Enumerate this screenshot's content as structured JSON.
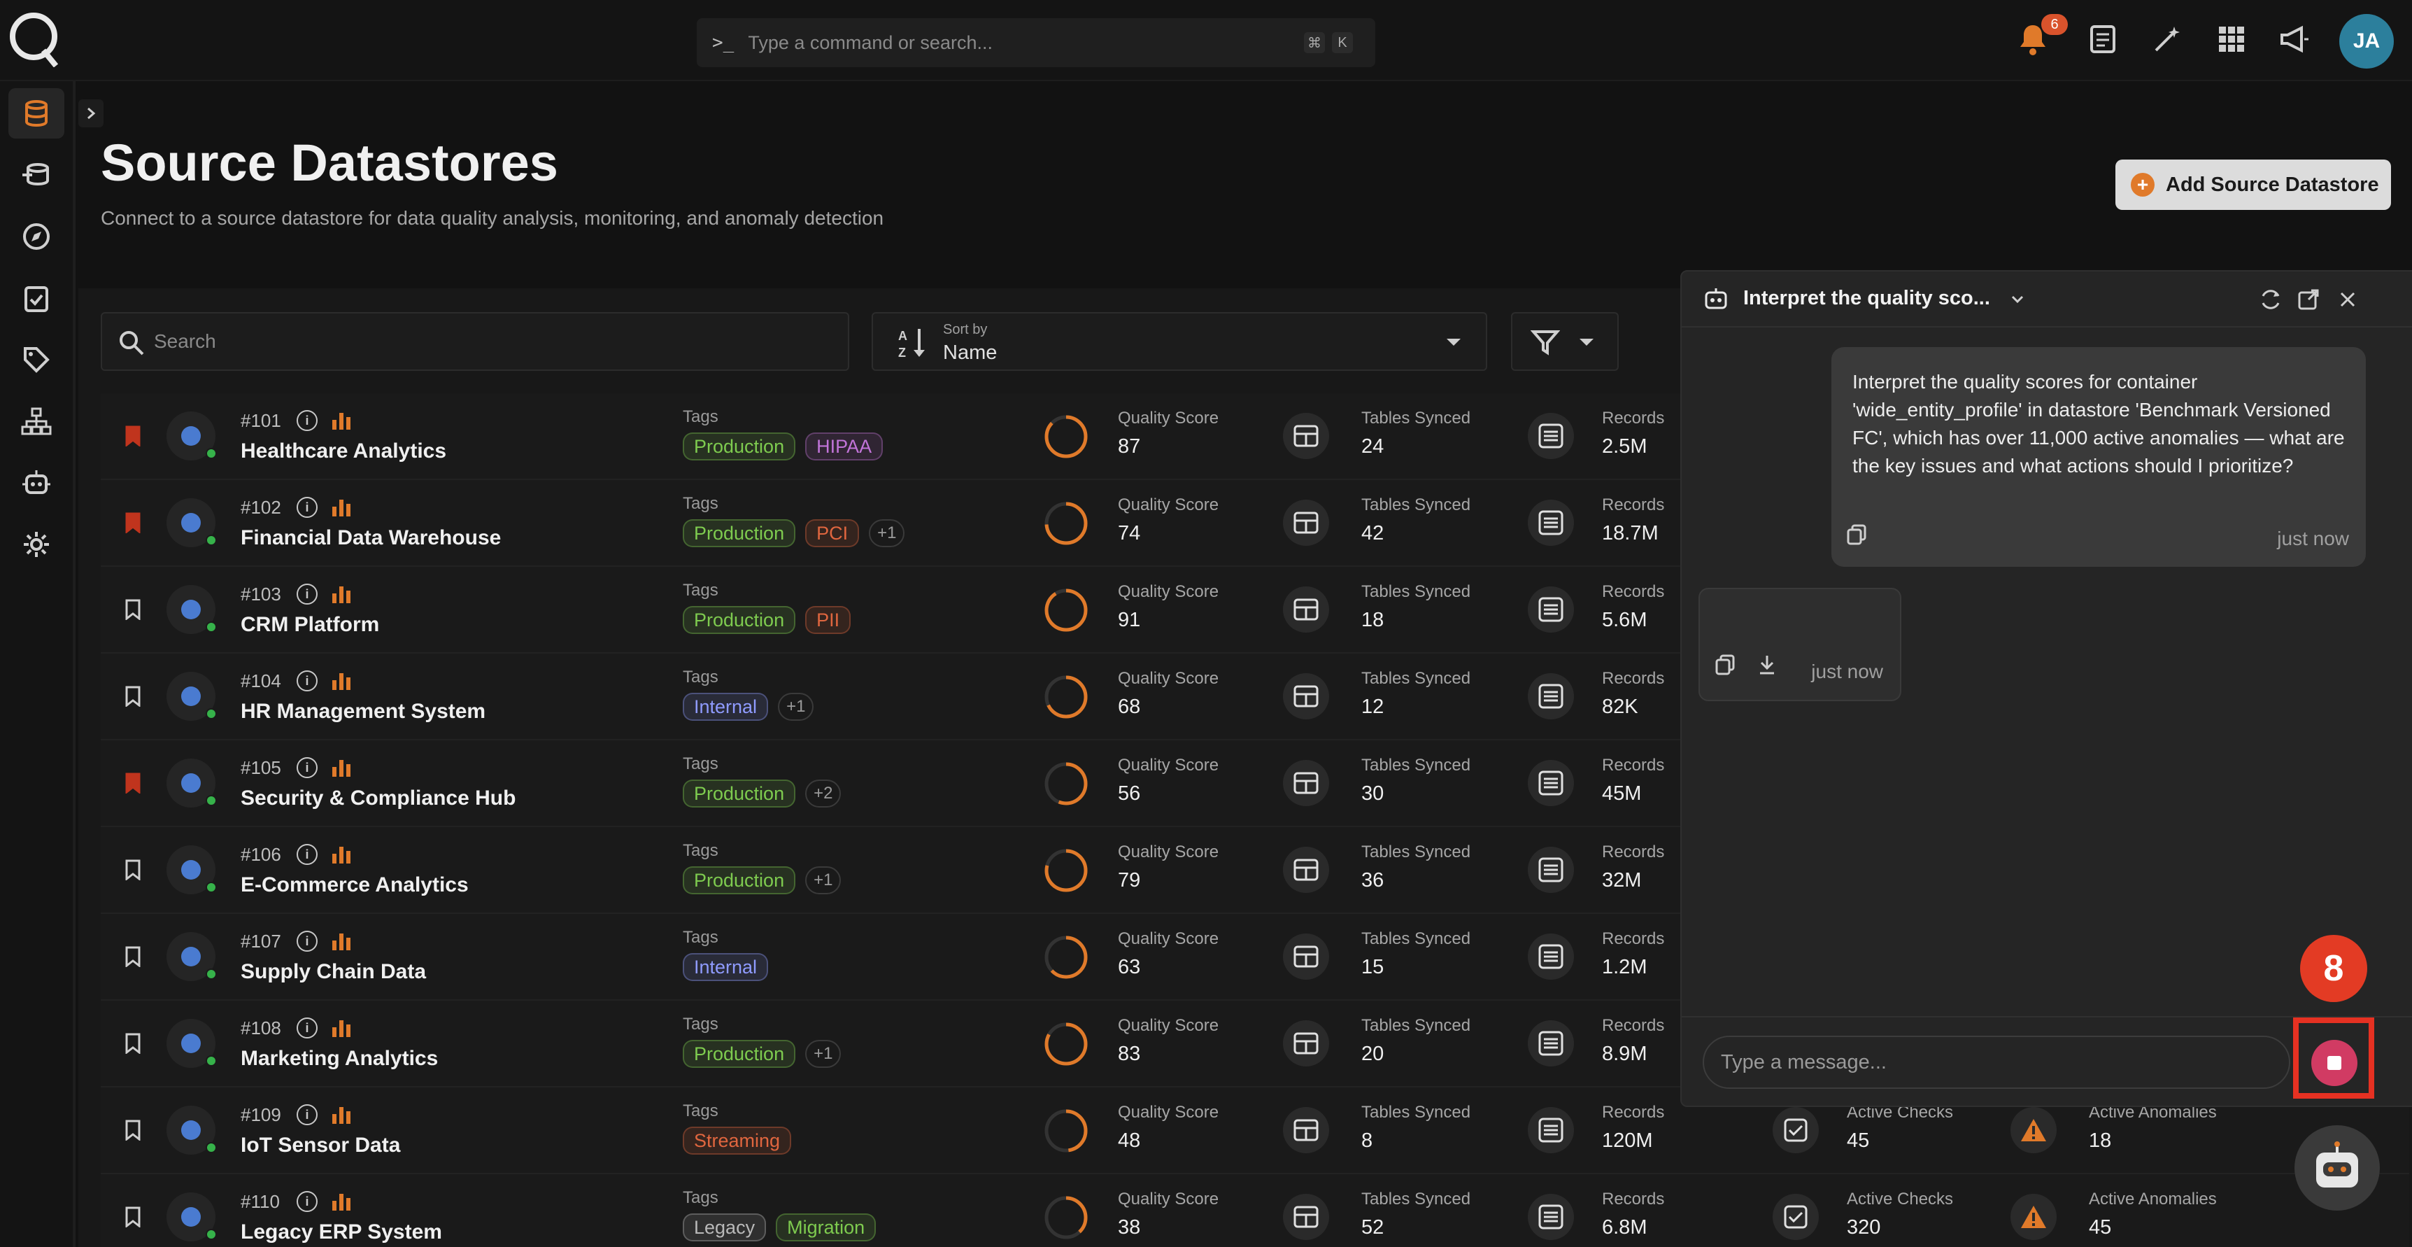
{
  "topbar": {
    "command_placeholder": "Type a command or search...",
    "shortcut_keys": [
      "⌘",
      "K"
    ],
    "notification_count": "6",
    "avatar_initials": "JA"
  },
  "header": {
    "title": "Source Datastores",
    "subtitle": "Connect to a source datastore for data quality analysis, monitoring, and anomaly detection",
    "add_button": "Add Source Datastore"
  },
  "toolbar": {
    "search_placeholder": "Search",
    "sort_label": "Sort by",
    "sort_value": "Name"
  },
  "labels": {
    "tags": "Tags",
    "quality_score": "Quality Score",
    "tables_synced": "Tables Synced",
    "records": "Records",
    "active_checks": "Active Checks",
    "active_anomalies": "Active Anomalies"
  },
  "datastores": [
    {
      "id": "#101",
      "name": "Healthcare Analytics",
      "bookmarked": true,
      "tags": [
        "Production",
        "HIPAA"
      ],
      "more": "",
      "quality": "87",
      "tables": "24",
      "records": "2.5M",
      "checks": "",
      "anomalies": ""
    },
    {
      "id": "#102",
      "name": "Financial Data Warehouse",
      "bookmarked": true,
      "tags": [
        "Production",
        "PCI"
      ],
      "more": "+1",
      "quality": "74",
      "tables": "42",
      "records": "18.7M",
      "checks": "",
      "anomalies": ""
    },
    {
      "id": "#103",
      "name": "CRM Platform",
      "bookmarked": false,
      "tags": [
        "Production",
        "PII"
      ],
      "more": "",
      "quality": "91",
      "tables": "18",
      "records": "5.6M",
      "checks": "",
      "anomalies": ""
    },
    {
      "id": "#104",
      "name": "HR Management System",
      "bookmarked": false,
      "tags": [
        "Internal"
      ],
      "more": "+1",
      "quality": "68",
      "tables": "12",
      "records": "82K",
      "checks": "",
      "anomalies": ""
    },
    {
      "id": "#105",
      "name": "Security & Compliance Hub",
      "bookmarked": true,
      "tags": [
        "Production"
      ],
      "more": "+2",
      "quality": "56",
      "tables": "30",
      "records": "45M",
      "checks": "",
      "anomalies": ""
    },
    {
      "id": "#106",
      "name": "E-Commerce Analytics",
      "bookmarked": false,
      "tags": [
        "Production"
      ],
      "more": "+1",
      "quality": "79",
      "tables": "36",
      "records": "32M",
      "checks": "",
      "anomalies": ""
    },
    {
      "id": "#107",
      "name": "Supply Chain Data",
      "bookmarked": false,
      "tags": [
        "Internal"
      ],
      "more": "",
      "quality": "63",
      "tables": "15",
      "records": "1.2M",
      "checks": "",
      "anomalies": ""
    },
    {
      "id": "#108",
      "name": "Marketing Analytics",
      "bookmarked": false,
      "tags": [
        "Production"
      ],
      "more": "+1",
      "quality": "83",
      "tables": "20",
      "records": "8.9M",
      "checks": "",
      "anomalies": ""
    },
    {
      "id": "#109",
      "name": "IoT Sensor Data",
      "bookmarked": false,
      "tags": [
        "Streaming"
      ],
      "more": "",
      "quality": "48",
      "tables": "8",
      "records": "120M",
      "checks": "45",
      "anomalies": "18"
    },
    {
      "id": "#110",
      "name": "Legacy ERP System",
      "bookmarked": false,
      "tags": [
        "Legacy",
        "Migration"
      ],
      "more": "",
      "quality": "38",
      "tables": "52",
      "records": "6.8M",
      "checks": "320",
      "anomalies": "45"
    }
  ],
  "tag_colors": {
    "Production": "#7ecb4f",
    "HIPAA": "#c274d9",
    "PCI": "#e0663f",
    "PII": "#e0663f",
    "Internal": "#8f9bff",
    "Streaming": "#e0663f",
    "Legacy": "#b9b9b9",
    "Migration": "#7ecb4f"
  },
  "chat": {
    "title": "Interpret the quality sco...",
    "user_message": "Interpret the quality scores for container 'wide_entity_profile' in datastore 'Benchmark Versioned FC', which has over 11,000 active anomalies — what are the key issues and what actions should I prioritize?",
    "user_time": "just now",
    "bot_time": "just now",
    "input_placeholder": "Type a message..."
  },
  "step_badge": "8",
  "colors": {
    "accent": "#e07a2a",
    "stop_button": "#d13b63",
    "highlight": "#e63122"
  }
}
